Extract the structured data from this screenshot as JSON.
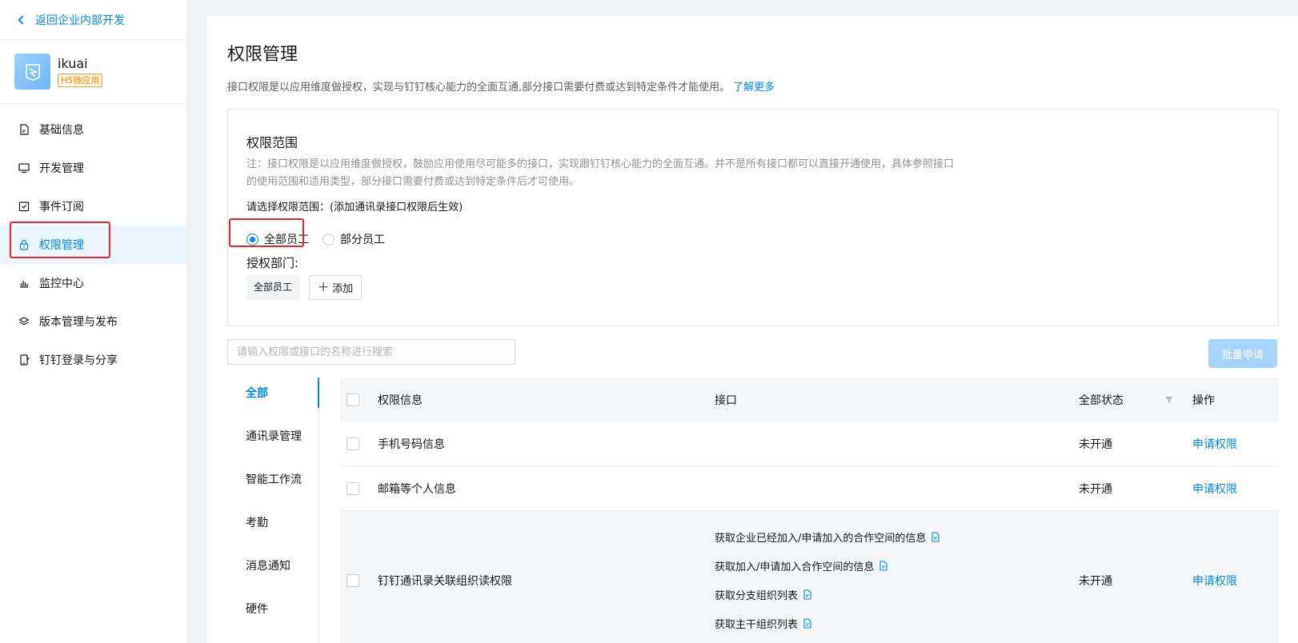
{
  "sidebar": {
    "back_label": "返回企业内部开发",
    "app": {
      "name": "ikuai",
      "badge": "H5微应用"
    },
    "items": [
      {
        "label": "基础信息",
        "icon": "document-icon"
      },
      {
        "label": "开发管理",
        "icon": "monitor-icon"
      },
      {
        "label": "事件订阅",
        "icon": "calendar-check-icon"
      },
      {
        "label": "权限管理",
        "icon": "lock-icon",
        "active": true
      },
      {
        "label": "监控中心",
        "icon": "bar-chart-icon"
      },
      {
        "label": "版本管理与发布",
        "icon": "layers-icon"
      },
      {
        "label": "钉钉登录与分享",
        "icon": "phone-share-icon"
      }
    ]
  },
  "main": {
    "title": "权限管理",
    "desc": "接口权限是以应用维度做授权，实现与钉钉核心能力的全面互通,部分接口需要付费或达到特定条件才能使用。",
    "learn_more": "了解更多",
    "scope": {
      "title": "权限范围",
      "note": "注：接口权限是以应用维度做授权，鼓励应用使用尽可能多的接口，实现跟钉钉核心能力的全面互通。并不是所有接口都可以直接开通使用，具体参照接口的使用范围和适用类型，部分接口需要付费或达到特定条件后才可使用。",
      "select_label": "请选择权限范围：(添加通讯录接口权限后生效)",
      "radio_all": "全部员工",
      "radio_part": "部分员工",
      "dept_label": "授权部门:",
      "dept_tag": "全部员工",
      "add_label": "添加"
    },
    "search_placeholder": "请输入权限或接口的名称进行搜索",
    "batch_label": "批量申请",
    "categories": [
      "全部",
      "通讯录管理",
      "智能工作流",
      "考勤",
      "消息通知",
      "硬件"
    ],
    "table": {
      "headers": {
        "info": "权限信息",
        "iface": "接口",
        "status": "全部状态",
        "action": "操作"
      },
      "rows": [
        {
          "name": "手机号码信息",
          "status": "未开通",
          "action": "申请权限"
        },
        {
          "name": "邮箱等个人信息",
          "status": "未开通",
          "action": "申请权限"
        },
        {
          "name": "钉钉通讯录关联组织读权限",
          "status": "未开通",
          "action": "申请权限",
          "interfaces": [
            "获取企业已经加入/申请加入的合作空间的信息",
            "获取加入/申请加入合作空间的信息",
            "获取分支组织列表",
            "获取主干组织列表"
          ]
        }
      ]
    }
  },
  "colors": {
    "accent": "#0089ff",
    "highlight": "#e5262b",
    "badge": "#ff8800"
  }
}
